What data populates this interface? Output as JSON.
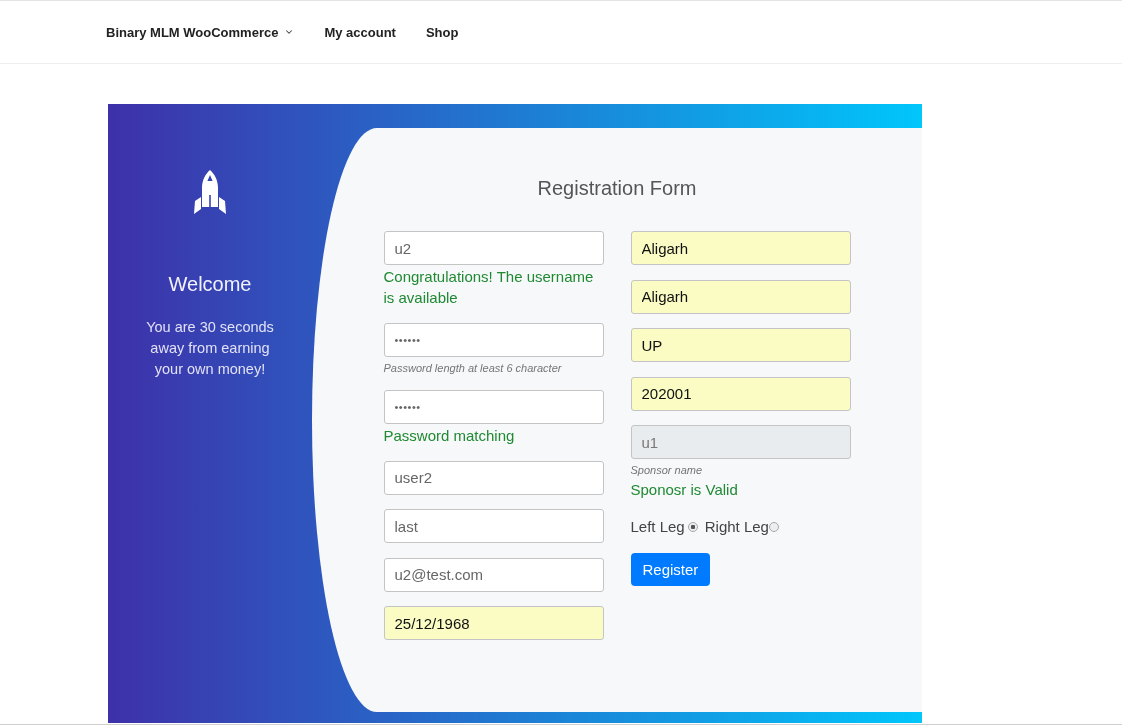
{
  "nav": {
    "items": [
      {
        "label": "Binary MLM WooCommerce",
        "has_submenu": true
      },
      {
        "label": "My account",
        "has_submenu": false
      },
      {
        "label": "Shop",
        "has_submenu": false
      }
    ]
  },
  "welcome": {
    "heading": "Welcome",
    "text": "You are 30 seconds away from earning your own money!"
  },
  "form": {
    "title": "Registration Form",
    "columns": [
      {
        "items": [
          {
            "kind": "text",
            "value": "u2",
            "autofilled": false,
            "disabled": false,
            "notes": [
              {
                "kind": "success",
                "text": "Congratulations! The username is available"
              }
            ]
          },
          {
            "kind": "password",
            "value": "••••••",
            "autofilled": false,
            "disabled": false,
            "notes": [
              {
                "kind": "hint",
                "text": "Password length at least 6 character"
              }
            ]
          },
          {
            "kind": "password",
            "value": "••••••",
            "autofilled": false,
            "disabled": false,
            "notes": [
              {
                "kind": "success",
                "text": "Password matching"
              }
            ]
          },
          {
            "kind": "text",
            "value": "user2",
            "autofilled": false,
            "disabled": false
          },
          {
            "kind": "text",
            "value": "last",
            "autofilled": false,
            "disabled": false
          },
          {
            "kind": "text",
            "value": "u2@test.com",
            "autofilled": false,
            "disabled": false
          },
          {
            "kind": "text",
            "value": "25/12/1968",
            "autofilled": true,
            "disabled": false
          }
        ]
      },
      {
        "items": [
          {
            "kind": "text",
            "value": "Aligarh",
            "autofilled": true,
            "disabled": false
          },
          {
            "kind": "text",
            "value": "Aligarh",
            "autofilled": true,
            "disabled": false
          },
          {
            "kind": "text",
            "value": "UP",
            "autofilled": true,
            "disabled": false
          },
          {
            "kind": "text",
            "value": "202001",
            "autofilled": true,
            "disabled": false
          },
          {
            "kind": "text",
            "value": "u1",
            "autofilled": false,
            "disabled": true,
            "notes": [
              {
                "kind": "hint",
                "text": "Sponsor name"
              },
              {
                "kind": "success",
                "text": "Sponosr is Valid"
              }
            ]
          },
          {
            "kind": "radio_group",
            "options": [
              {
                "label": "Left Leg",
                "selected": true
              },
              {
                "label": "Right Leg",
                "selected": false
              }
            ]
          },
          {
            "kind": "button",
            "label": "Register"
          }
        ]
      }
    ]
  }
}
